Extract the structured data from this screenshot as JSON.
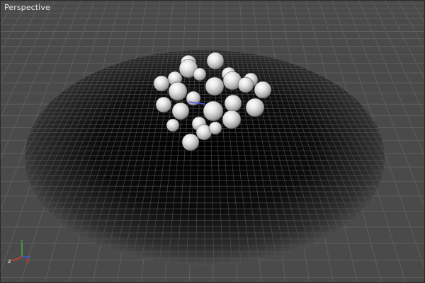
{
  "viewport": {
    "label": "Perspective"
  },
  "scene": {
    "objects": "sphere-cluster",
    "surface": "circular-dish-with-grid",
    "ground": "grid-plane"
  },
  "axis_gizmo": {
    "axes": [
      "x",
      "y",
      "z"
    ],
    "colors": {
      "x": "#d23a3a",
      "y": "#3fb04a",
      "z": "#3a5ad2"
    }
  },
  "colors": {
    "background": "#4a4a4a",
    "grid_line": "#5e5e5e",
    "dish_dark": "#050505",
    "sphere_light": "#f2f2f2",
    "sphere_shadow": "#7a7a7a"
  }
}
